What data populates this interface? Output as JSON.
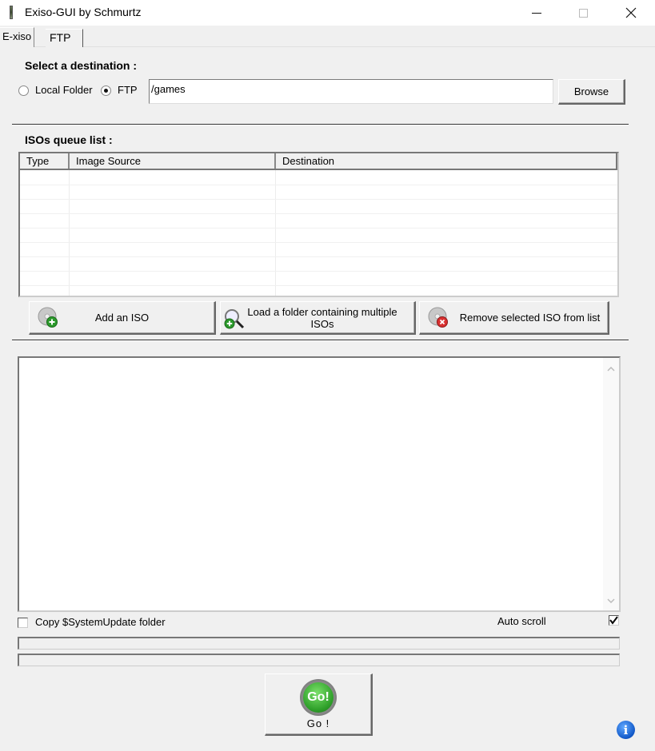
{
  "window": {
    "title": "Exiso-GUI by Schmurtz",
    "minimize_glyph": "—",
    "maximize_glyph": "☐",
    "close_glyph": "✕"
  },
  "tabs": [
    {
      "label": "E-xiso",
      "active": true
    },
    {
      "label": "FTP",
      "active": false
    }
  ],
  "destination": {
    "title": "Select a destination :",
    "options": [
      {
        "label": "Local Folder",
        "checked": false
      },
      {
        "label": "FTP",
        "checked": true
      }
    ],
    "path_value": "/games",
    "browse_label": "Browse"
  },
  "queue": {
    "title": "ISOs queue list :",
    "columns": [
      "Type",
      "Image Source",
      "Destination"
    ],
    "rows": []
  },
  "actions": {
    "add_iso": "Add an ISO",
    "load_folder_line1": "Load a folder containing multiple",
    "load_folder_line2": "ISOs",
    "remove_selected": "Remove selected ISO from list"
  },
  "log": {
    "text": "",
    "scroll_up_glyph": "^",
    "scroll_down_glyph": "v"
  },
  "options": {
    "copy_system_update": {
      "label": "Copy $SystemUpdate folder",
      "checked": false
    },
    "auto_scroll": {
      "label": "Auto scroll",
      "checked": true,
      "check_glyph": "✔"
    }
  },
  "progress": {
    "bar1": 0,
    "bar2": 0
  },
  "go": {
    "badge_text": "Go!",
    "label": "Go !"
  },
  "info_glyph": "i",
  "colors": {
    "go_green": "#2fa02a",
    "info_blue": "#1158c8",
    "add_green": "#2c9a2c",
    "remove_red": "#d93030"
  }
}
